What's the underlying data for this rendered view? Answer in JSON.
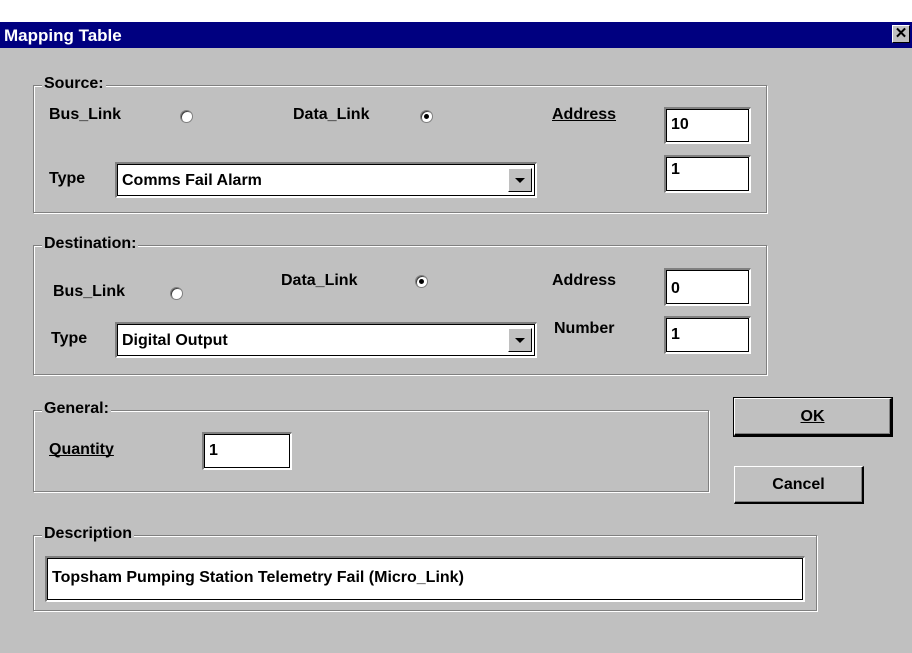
{
  "window": {
    "title": "Mapping Table",
    "close_glyph": "✕"
  },
  "source": {
    "legend": "Source:",
    "bus_link_label": "Bus_Link",
    "data_link_label": "Data_Link",
    "selected": "Data_Link",
    "address_label": "Address",
    "address_value": "10",
    "type_label": "Type",
    "type_value": "Comms Fail Alarm",
    "number_value": "1"
  },
  "destination": {
    "legend": "Destination:",
    "bus_link_label": "Bus_Link",
    "data_link_label": "Data_Link",
    "selected": "Data_Link",
    "address_label": "Address",
    "address_value": "0",
    "type_label": "Type",
    "type_value": "Digital Output",
    "number_label": "Number",
    "number_value": "1"
  },
  "general": {
    "legend": "General:",
    "quantity_label": "Quantity",
    "quantity_value": "1"
  },
  "description": {
    "legend": "Description",
    "value": "Topsham Pumping Station Telemetry Fail (Micro_Link)"
  },
  "buttons": {
    "ok_label": "OK",
    "cancel_label": "Cancel"
  }
}
